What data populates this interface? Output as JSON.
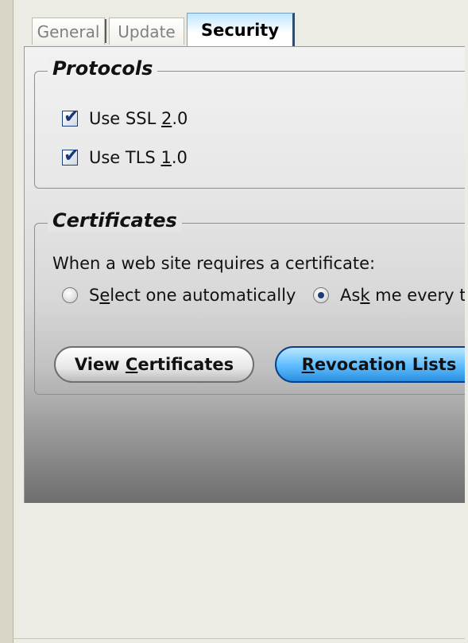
{
  "tabs": [
    {
      "label": "General"
    },
    {
      "label": "Update"
    },
    {
      "label": "Security",
      "active": true
    }
  ],
  "protocols": {
    "title": "Protocols",
    "options": [
      {
        "pre": "Use SSL ",
        "key": "2",
        "post": ".0",
        "checked": true
      },
      {
        "pre": "Use TLS ",
        "key": "1",
        "post": ".0",
        "checked": true
      }
    ]
  },
  "certificates": {
    "title": "Certificates",
    "prompt": "When a web site requires a certificate:",
    "radio_auto": {
      "pre": "S",
      "key": "e",
      "post": "lect one automatically",
      "selected": false
    },
    "radio_ask": {
      "pre": "As",
      "key": "k",
      "post": " me every ti",
      "selected": true
    },
    "button_view": {
      "pre": "View ",
      "key": "C",
      "post": "ertificates"
    },
    "button_revoke": {
      "pre": "",
      "key": "R",
      "post": "evocation Lists"
    }
  },
  "colors": {
    "check_mark": "#19387a",
    "revoke_button": "#5cbcff",
    "active_tab": "#bfe6ff"
  },
  "icons": {
    "checkbox": "checkmark-icon",
    "radio_selected": "radio-dot-icon"
  }
}
